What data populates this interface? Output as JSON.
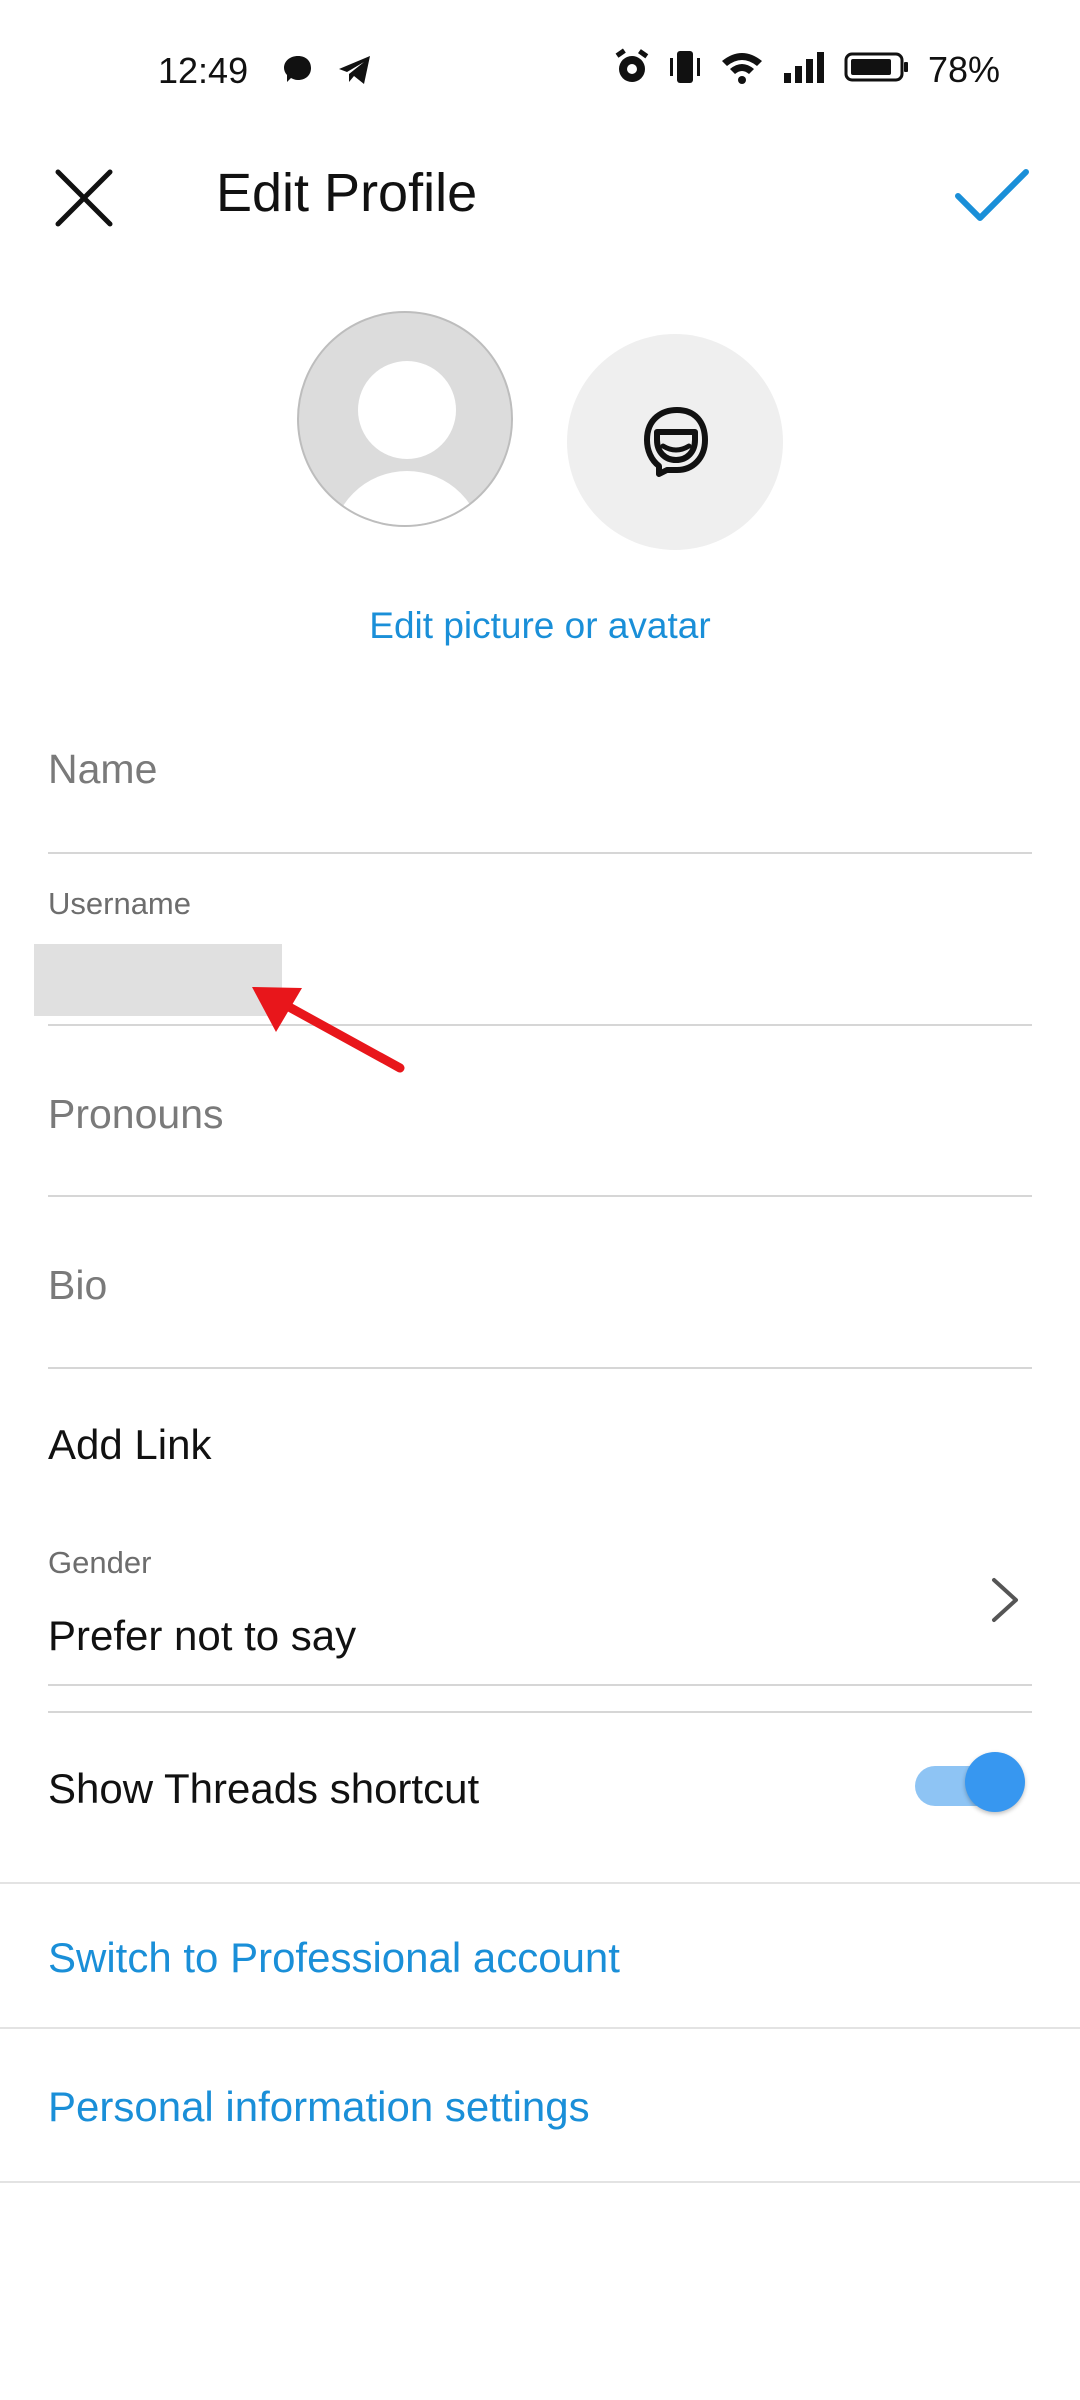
{
  "status_bar": {
    "time": "12:49",
    "battery": "78%",
    "icons": [
      "threads-icon",
      "telegram-icon",
      "alarm-icon",
      "vibrate-icon",
      "wifi-icon",
      "signal-icon",
      "battery-icon"
    ]
  },
  "header": {
    "title": "Edit Profile",
    "close_icon": "close-icon",
    "done_icon": "checkmark-icon"
  },
  "profile": {
    "edit_picture_label": "Edit picture or avatar"
  },
  "fields": {
    "name_placeholder": "Name",
    "username_label": "Username",
    "username_value": "",
    "pronouns_placeholder": "Pronouns",
    "bio_placeholder": "Bio",
    "add_link_label": "Add Link",
    "gender_label": "Gender",
    "gender_value": "Prefer not to say"
  },
  "settings": {
    "threads_shortcut_label": "Show Threads shortcut",
    "threads_shortcut_enabled": true,
    "switch_professional_label": "Switch to Professional account",
    "personal_info_label": "Personal information settings"
  },
  "colors": {
    "accent": "#1a8fd8",
    "toggle_on": "#3797f0",
    "annotation_arrow": "#e8161b"
  }
}
